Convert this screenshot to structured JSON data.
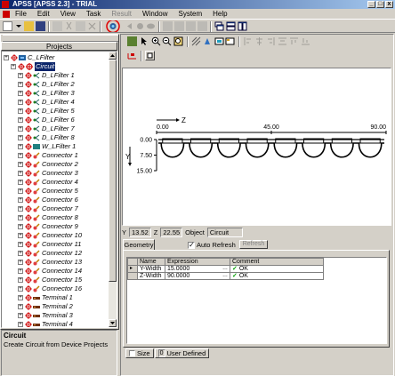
{
  "window": {
    "title": "APSS [APSS 2.3] - TRIAL",
    "buttons": [
      "_",
      "□",
      "x"
    ]
  },
  "menubar": [
    "File",
    "Edit",
    "View",
    "Task",
    "Result",
    "Window",
    "System",
    "Help"
  ],
  "menubar_disabled": [
    4
  ],
  "projects": {
    "title": "Projects",
    "items": [
      {
        "label": "C_LFilter",
        "level": 0,
        "icon": "project-icon"
      },
      {
        "label": "Circuit",
        "level": 1,
        "icon": "circuit-icon",
        "selected": true
      },
      {
        "label": "D_LFilter 1",
        "level": 2,
        "icon": "filter-icon"
      },
      {
        "label": "D_LFilter 2",
        "level": 2,
        "icon": "filter-icon"
      },
      {
        "label": "D_LFilter 3",
        "level": 2,
        "icon": "filter-icon"
      },
      {
        "label": "D_LFilter 4",
        "level": 2,
        "icon": "filter-icon"
      },
      {
        "label": "D_LFilter 5",
        "level": 2,
        "icon": "filter-icon"
      },
      {
        "label": "D_LFilter 6",
        "level": 2,
        "icon": "filter-icon"
      },
      {
        "label": "D_LFilter 7",
        "level": 2,
        "icon": "filter-icon"
      },
      {
        "label": "D_LFilter 8",
        "level": 2,
        "icon": "filter-icon"
      },
      {
        "label": "W_LFilter 1",
        "level": 2,
        "icon": "block-icon"
      },
      {
        "label": "Connector 1",
        "level": 2,
        "icon": "connector-icon"
      },
      {
        "label": "Connector 2",
        "level": 2,
        "icon": "connector-icon"
      },
      {
        "label": "Connector 3",
        "level": 2,
        "icon": "connector-icon"
      },
      {
        "label": "Connector 4",
        "level": 2,
        "icon": "connector-icon"
      },
      {
        "label": "Connector 5",
        "level": 2,
        "icon": "connector-icon"
      },
      {
        "label": "Connector 6",
        "level": 2,
        "icon": "connector-icon"
      },
      {
        "label": "Connector 7",
        "level": 2,
        "icon": "connector-icon"
      },
      {
        "label": "Connector 8",
        "level": 2,
        "icon": "connector-icon"
      },
      {
        "label": "Connector 9",
        "level": 2,
        "icon": "connector-icon"
      },
      {
        "label": "Connector 10",
        "level": 2,
        "icon": "connector-icon"
      },
      {
        "label": "Connector 11",
        "level": 2,
        "icon": "connector-icon"
      },
      {
        "label": "Connector 12",
        "level": 2,
        "icon": "connector-icon"
      },
      {
        "label": "Connector 13",
        "level": 2,
        "icon": "connector-icon"
      },
      {
        "label": "Connector 14",
        "level": 2,
        "icon": "connector-icon"
      },
      {
        "label": "Connector 15",
        "level": 2,
        "icon": "connector-icon"
      },
      {
        "label": "Connector 16",
        "level": 2,
        "icon": "connector-icon"
      },
      {
        "label": "Terminal 1",
        "level": 2,
        "icon": "terminal-icon"
      },
      {
        "label": "Terminal 2",
        "level": 2,
        "icon": "terminal-icon"
      },
      {
        "label": "Terminal 3",
        "level": 2,
        "icon": "terminal-icon"
      },
      {
        "label": "Terminal 4",
        "level": 2,
        "icon": "terminal-icon"
      }
    ]
  },
  "description": {
    "title": "Circuit",
    "text": "Create Circuit from Device Projects"
  },
  "plot": {
    "z_axis_label": "Z",
    "y_axis_label": "Y",
    "z_ticks": [
      "0.00",
      "45.00",
      "90.00"
    ],
    "y_ticks": [
      "0.00",
      "7.50",
      "15.00"
    ],
    "units": 8
  },
  "statusline": {
    "y_label": "Y",
    "y_value": "13.52",
    "z_label": "Z",
    "z_value": "22.55",
    "object_label": "Object",
    "object_value": "Circuit"
  },
  "geometry": {
    "tab": "Geometry",
    "auto_refresh_label": "Auto Refresh",
    "auto_refresh_checked": true,
    "refresh_button": "Refresh",
    "columns": [
      "Name",
      "Expression",
      "Comment"
    ],
    "rows": [
      {
        "name": "Y-Width",
        "expression": "15.0000",
        "comment": "OK"
      },
      {
        "name": "Z-Width",
        "expression": "90.0000",
        "comment": "OK"
      }
    ]
  },
  "bottom_tabs": [
    "Size",
    "0",
    "User Defined"
  ],
  "colors": {
    "title_start": "#0a246a",
    "title_end": "#a6caf0",
    "selection": "#0a246a",
    "highlight_circle": "#e00000",
    "ok_check": "#00a000"
  }
}
